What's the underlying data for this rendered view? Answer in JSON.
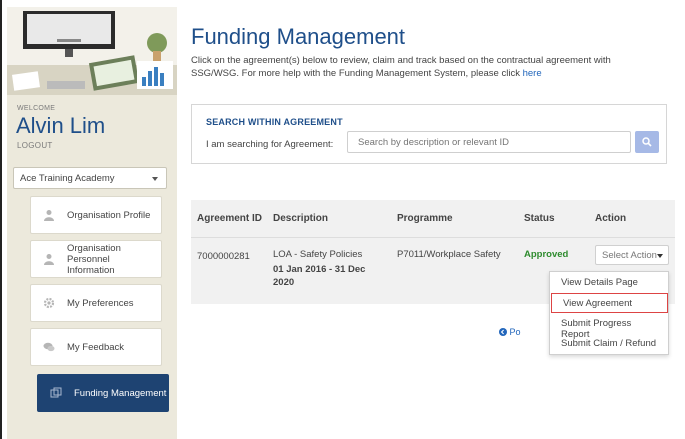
{
  "sidebar": {
    "welcome": "WELCOME",
    "user_name": "Alvin Lim",
    "logout": "LOGOUT",
    "organisation": "Ace Training Academy",
    "items": [
      {
        "label": "Organisation Profile",
        "icon": "user-icon"
      },
      {
        "label": "Organisation Personnel Information",
        "icon": "user-icon"
      },
      {
        "label": "My Preferences",
        "icon": "gear-icon"
      },
      {
        "label": "My Feedback",
        "icon": "chat-icon"
      },
      {
        "label": "Funding Management",
        "icon": "funding-icon"
      }
    ]
  },
  "main": {
    "title": "Funding Management",
    "intro": "Click on the agreement(s) below to review, claim and track based on the contractual agreement with SSG/WSG. For more help with the Funding Management System, please click ",
    "intro_link": "here",
    "search": {
      "title": "SEARCH WITHIN AGREEMENT",
      "label": "I am searching for Agreement:",
      "placeholder": "Search by description or relevant ID"
    },
    "table": {
      "headers": [
        "Agreement ID",
        "Description",
        "Programme",
        "Status",
        "Action"
      ],
      "rows": [
        {
          "id": "7000000281",
          "description": "LOA - Safety Policies",
          "period": "01 Jan 2016 - 31 Dec 2020",
          "programme": "P7011/Workplace Safety",
          "status": "Approved",
          "action": "Select Action"
        }
      ]
    },
    "portal_link_partial": "Po",
    "action_menu": [
      "View Details Page",
      "View Agreement",
      "Submit Progress Report",
      "Submit Claim / Refund"
    ]
  },
  "colors": {
    "brand_blue": "#1f4f8a",
    "active_nav": "#1e4372",
    "approved": "#2e8b2e",
    "highlight_border": "#dd4444"
  }
}
